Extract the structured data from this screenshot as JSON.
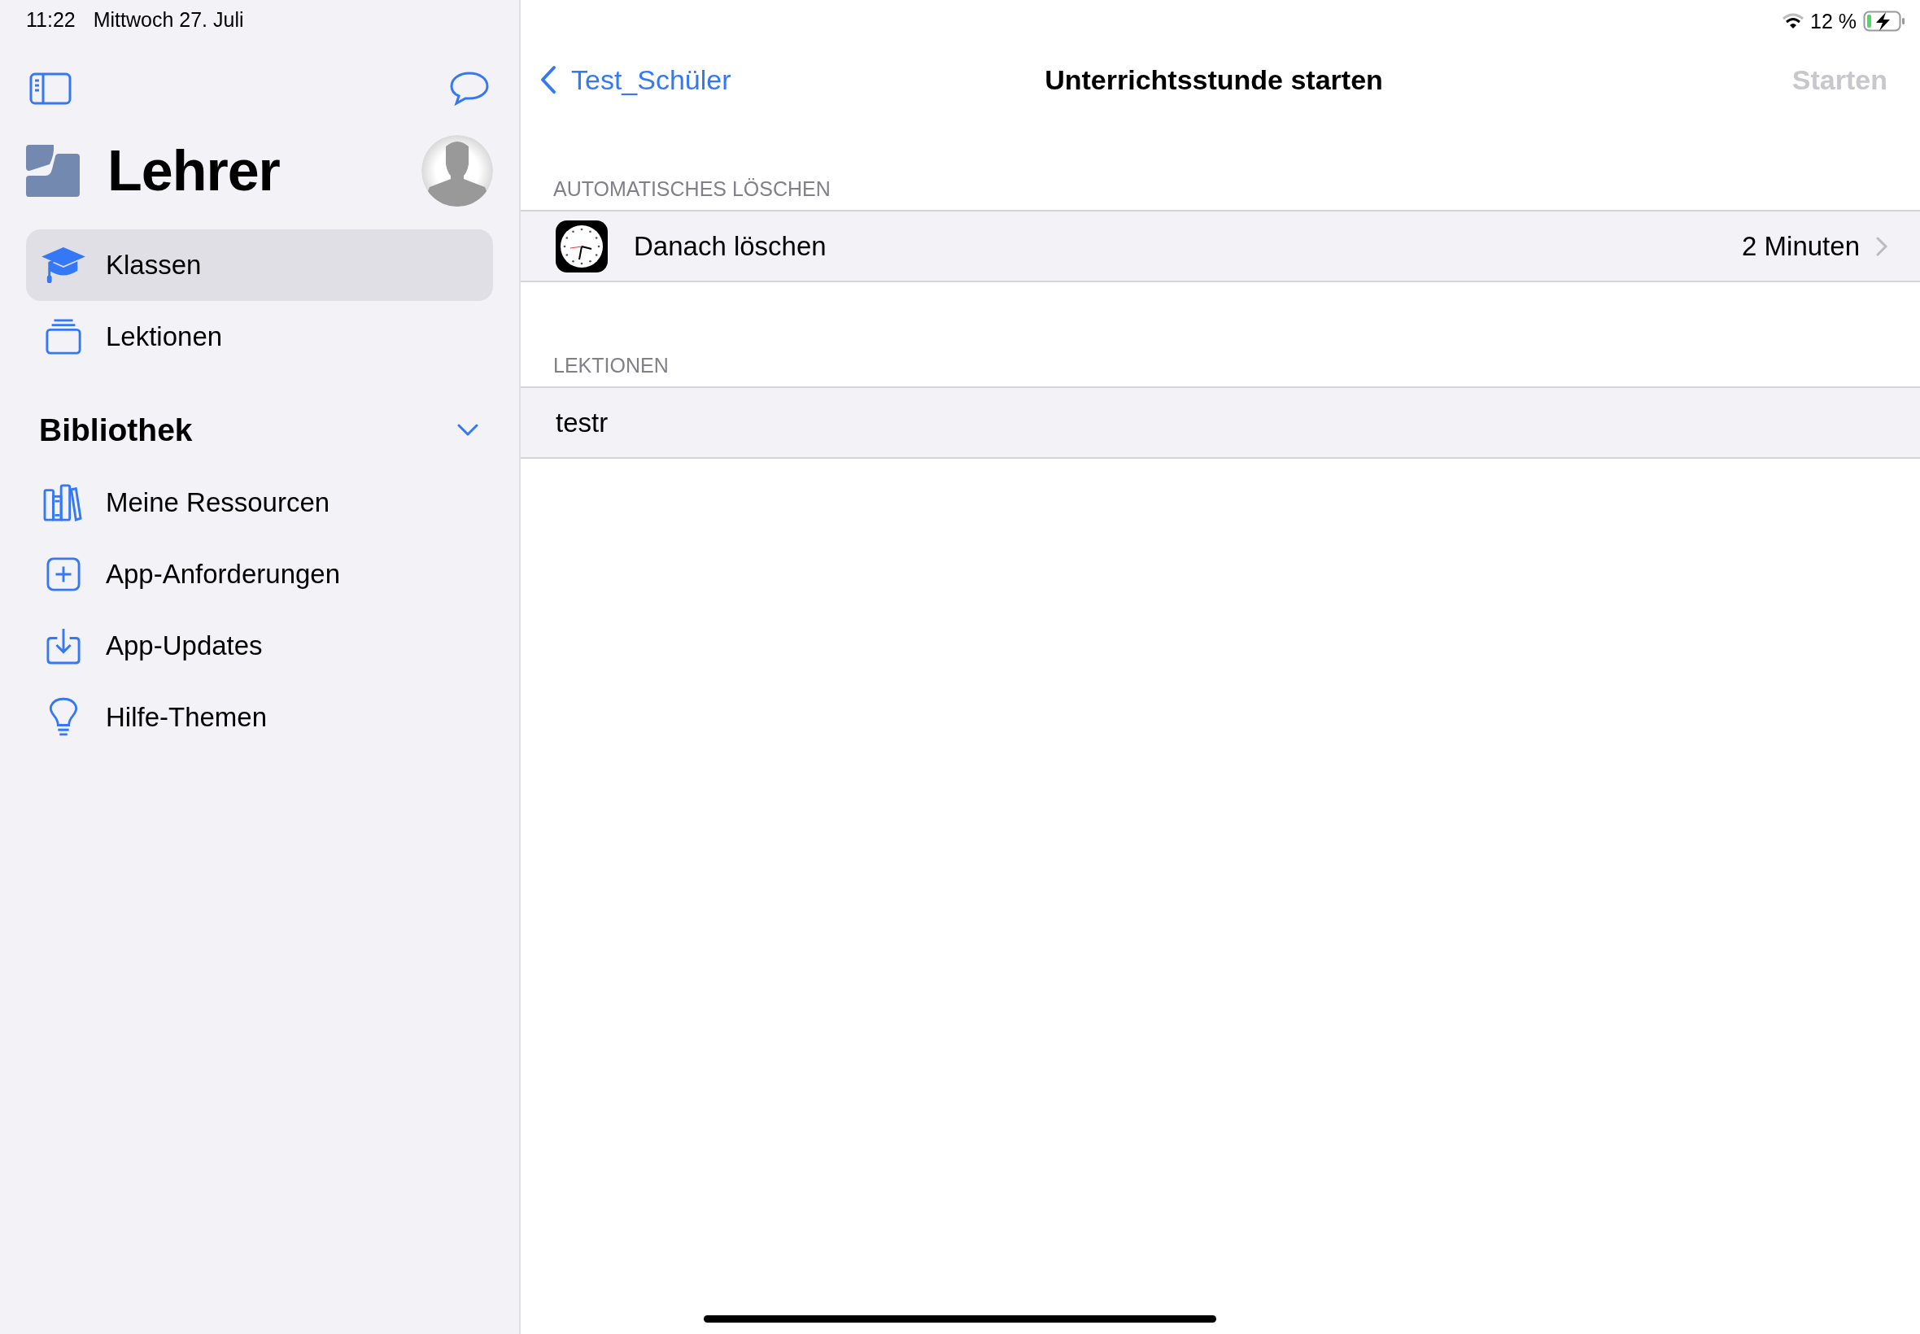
{
  "status_bar": {
    "time": "11:22",
    "date": "Mittwoch 27. Juli",
    "battery": "12 %"
  },
  "sidebar": {
    "title": "Lehrer",
    "items": [
      {
        "label": "Klassen",
        "selected": true
      },
      {
        "label": "Lektionen",
        "selected": false
      }
    ],
    "library": {
      "title": "Bibliothek",
      "expanded": true,
      "items": [
        {
          "label": "Meine Ressourcen",
          "selected": false
        },
        {
          "label": "App-Anforderungen",
          "selected": false
        },
        {
          "label": "App-Updates",
          "selected": false
        },
        {
          "label": "Hilfe-Themen",
          "selected": false
        }
      ]
    }
  },
  "nav": {
    "back": "Test_Schüler",
    "title": "Unterrichtsstunde starten",
    "action": {
      "label": "Starten",
      "disabled": true
    }
  },
  "sections": [
    {
      "header": "AUTOMATISCHES LÖSCHEN",
      "rows": [
        {
          "kind": "setting",
          "label": "Danach löschen",
          "value": "2 Minuten"
        }
      ]
    },
    {
      "header": "LEKTIONEN",
      "rows": [
        {
          "kind": "plain",
          "label": "testr"
        }
      ]
    }
  ]
}
